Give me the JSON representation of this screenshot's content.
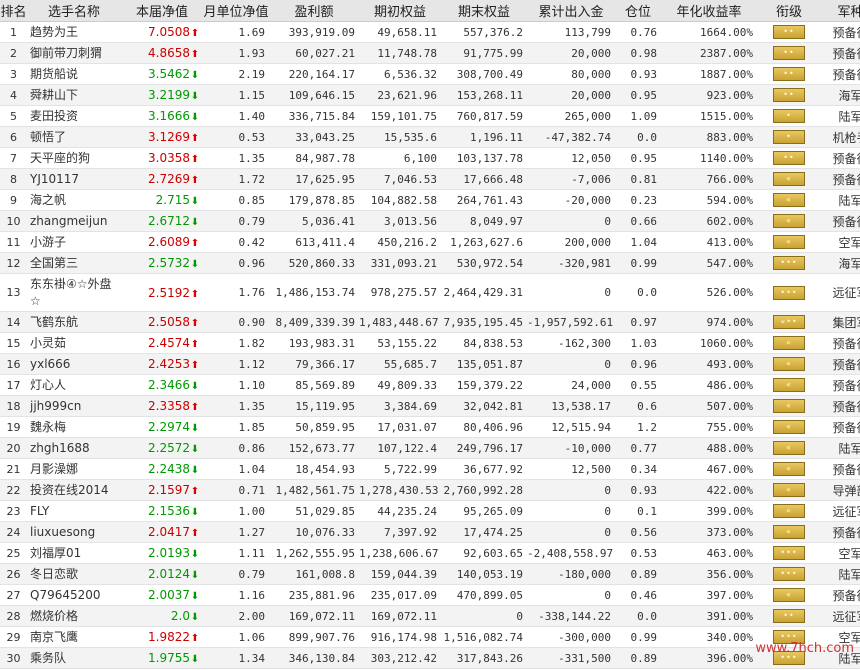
{
  "headers": [
    "排名",
    "选手名称",
    "本届净值",
    "月单位净值",
    "盈利额",
    "期初权益",
    "期末权益",
    "累计出入金",
    "仓位",
    "年化收益率",
    "衔级",
    "军种"
  ],
  "rows": [
    {
      "rank": "1",
      "name": "趋势为王",
      "nav": "7.0508",
      "dir": "up",
      "unit": "1.69",
      "profit": "393,919.09",
      "start": "49,658.11",
      "end": "557,376.2",
      "flow": "113,799",
      "pos": "0.76",
      "annual": "1664.00%",
      "badge": "••",
      "army": "预备役"
    },
    {
      "rank": "2",
      "name": "御前带刀刺猬",
      "nav": "4.8658",
      "dir": "up",
      "unit": "1.93",
      "profit": "60,027.21",
      "start": "11,748.78",
      "end": "91,775.99",
      "flow": "20,000",
      "pos": "0.98",
      "annual": "2387.00%",
      "badge": "••",
      "army": "预备役"
    },
    {
      "rank": "3",
      "name": "期货船说",
      "nav": "3.5462",
      "dir": "dn",
      "unit": "2.19",
      "profit": "220,164.17",
      "start": "6,536.32",
      "end": "308,700.49",
      "flow": "80,000",
      "pos": "0.93",
      "annual": "1887.00%",
      "badge": "••",
      "army": "预备役"
    },
    {
      "rank": "4",
      "name": "舜耕山下",
      "nav": "3.2199",
      "dir": "dn",
      "unit": "1.15",
      "profit": "109,646.15",
      "start": "23,621.96",
      "end": "153,268.11",
      "flow": "20,000",
      "pos": "0.95",
      "annual": "923.00%",
      "badge": "••",
      "army": "海军"
    },
    {
      "rank": "5",
      "name": "麦田投资",
      "nav": "3.1666",
      "dir": "dn",
      "unit": "1.40",
      "profit": "336,715.84",
      "start": "159,101.75",
      "end": "760,817.59",
      "flow": "265,000",
      "pos": "1.09",
      "annual": "1515.00%",
      "badge": "•",
      "army": "陆军"
    },
    {
      "rank": "6",
      "name": "顿悟了",
      "nav": "3.1269",
      "dir": "up",
      "unit": "0.53",
      "profit": "33,043.25",
      "start": "15,535.6",
      "end": "1,196.11",
      "flow": "-47,382.74",
      "pos": "0.0",
      "annual": "883.00%",
      "badge": "•",
      "army": "机枪手"
    },
    {
      "rank": "7",
      "name": "天平座的狗",
      "nav": "3.0358",
      "dir": "up",
      "unit": "1.35",
      "profit": "84,987.78",
      "start": "6,100",
      "end": "103,137.78",
      "flow": "12,050",
      "pos": "0.95",
      "annual": "1140.00%",
      "badge": "••",
      "army": "预备役"
    },
    {
      "rank": "8",
      "name": "YJ10117",
      "nav": "2.7269",
      "dir": "up",
      "unit": "1.72",
      "profit": "17,625.95",
      "start": "7,046.53",
      "end": "17,666.48",
      "flow": "-7,006",
      "pos": "0.81",
      "annual": "766.00%",
      "badge": "«",
      "army": "预备役"
    },
    {
      "rank": "9",
      "name": "海之帆",
      "nav": "2.715",
      "dir": "dn",
      "unit": "0.85",
      "profit": "179,878.85",
      "start": "104,882.58",
      "end": "264,761.43",
      "flow": "-20,000",
      "pos": "0.23",
      "annual": "594.00%",
      "badge": "«",
      "army": "陆军"
    },
    {
      "rank": "10",
      "name": "zhangmeijun",
      "nav": "2.6712",
      "dir": "dn",
      "unit": "0.79",
      "profit": "5,036.41",
      "start": "3,013.56",
      "end": "8,049.97",
      "flow": "0",
      "pos": "0.66",
      "annual": "602.00%",
      "badge": "«",
      "army": "预备役"
    },
    {
      "rank": "11",
      "name": "小游子",
      "nav": "2.6089",
      "dir": "up",
      "unit": "0.42",
      "profit": "613,411.4",
      "start": "450,216.2",
      "end": "1,263,627.6",
      "flow": "200,000",
      "pos": "1.04",
      "annual": "413.00%",
      "badge": "«",
      "army": "空军"
    },
    {
      "rank": "12",
      "name": "全国第三",
      "nav": "2.5732",
      "dir": "dn",
      "unit": "0.96",
      "profit": "520,860.33",
      "start": "331,093.21",
      "end": "530,972.54",
      "flow": "-320,981",
      "pos": "0.99",
      "annual": "547.00%",
      "badge": "•••",
      "army": "海军"
    },
    {
      "rank": "13",
      "name": "东东褂④☆外盘☆",
      "nav": "2.5192",
      "dir": "up",
      "unit": "1.76",
      "profit": "1,486,153.74",
      "start": "978,275.57",
      "end": "2,464,429.31",
      "flow": "0",
      "pos": "0.0",
      "annual": "526.00%",
      "badge": "•••",
      "army": "远征军"
    },
    {
      "rank": "14",
      "name": "飞鹤东航",
      "nav": "2.5058",
      "dir": "up",
      "unit": "0.90",
      "profit": "8,409,339.39",
      "start": "1,483,448.67",
      "end": "7,935,195.45",
      "flow": "-1,957,592.61",
      "pos": "0.97",
      "annual": "974.00%",
      "badge": "«••",
      "army": "集团军"
    },
    {
      "rank": "15",
      "name": "小灵茹",
      "nav": "2.4574",
      "dir": "up",
      "unit": "1.82",
      "profit": "193,983.31",
      "start": "53,155.22",
      "end": "84,838.53",
      "flow": "-162,300",
      "pos": "1.03",
      "annual": "1060.00%",
      "badge": "«",
      "army": "预备役"
    },
    {
      "rank": "16",
      "name": "yxl666",
      "nav": "2.4253",
      "dir": "up",
      "unit": "1.12",
      "profit": "79,366.17",
      "start": "55,685.7",
      "end": "135,051.87",
      "flow": "0",
      "pos": "0.96",
      "annual": "493.00%",
      "badge": "«",
      "army": "预备役"
    },
    {
      "rank": "17",
      "name": "灯心人",
      "nav": "2.3466",
      "dir": "dn",
      "unit": "1.10",
      "profit": "85,569.89",
      "start": "49,809.33",
      "end": "159,379.22",
      "flow": "24,000",
      "pos": "0.55",
      "annual": "486.00%",
      "badge": "«",
      "army": "预备役"
    },
    {
      "rank": "18",
      "name": "jjh999cn",
      "nav": "2.3358",
      "dir": "up",
      "unit": "1.35",
      "profit": "15,119.95",
      "start": "3,384.69",
      "end": "32,042.81",
      "flow": "13,538.17",
      "pos": "0.6",
      "annual": "507.00%",
      "badge": "«",
      "army": "预备役"
    },
    {
      "rank": "19",
      "name": "魏永梅",
      "nav": "2.2974",
      "dir": "dn",
      "unit": "1.85",
      "profit": "50,859.95",
      "start": "17,031.07",
      "end": "80,406.96",
      "flow": "12,515.94",
      "pos": "1.2",
      "annual": "755.00%",
      "badge": "«",
      "army": "预备役"
    },
    {
      "rank": "20",
      "name": "zhgh1688",
      "nav": "2.2572",
      "dir": "dn",
      "unit": "0.86",
      "profit": "152,673.77",
      "start": "107,122.4",
      "end": "249,796.17",
      "flow": "-10,000",
      "pos": "0.77",
      "annual": "488.00%",
      "badge": "«",
      "army": "陆军"
    },
    {
      "rank": "21",
      "name": "月影澡娜",
      "nav": "2.2438",
      "dir": "dn",
      "unit": "1.04",
      "profit": "18,454.93",
      "start": "5,722.99",
      "end": "36,677.92",
      "flow": "12,500",
      "pos": "0.34",
      "annual": "467.00%",
      "badge": "«",
      "army": "预备役"
    },
    {
      "rank": "22",
      "name": "投资在线2014",
      "nav": "2.1597",
      "dir": "up",
      "unit": "0.71",
      "profit": "1,482,561.75",
      "start": "1,278,430.53",
      "end": "2,760,992.28",
      "flow": "0",
      "pos": "0.93",
      "annual": "422.00%",
      "badge": "«",
      "army": "导弹部"
    },
    {
      "rank": "23",
      "name": "FLY",
      "nav": "2.1536",
      "dir": "dn",
      "unit": "1.00",
      "profit": "51,029.85",
      "start": "44,235.24",
      "end": "95,265.09",
      "flow": "0",
      "pos": "0.1",
      "annual": "399.00%",
      "badge": "«",
      "army": "远征军"
    },
    {
      "rank": "24",
      "name": "liuxuesong",
      "nav": "2.0417",
      "dir": "up",
      "unit": "1.27",
      "profit": "10,076.33",
      "start": "7,397.92",
      "end": "17,474.25",
      "flow": "0",
      "pos": "0.56",
      "annual": "373.00%",
      "badge": "«",
      "army": "预备役"
    },
    {
      "rank": "25",
      "name": "刘福厚01",
      "nav": "2.0193",
      "dir": "dn",
      "unit": "1.11",
      "profit": "1,262,555.95",
      "start": "1,238,606.67",
      "end": "92,603.65",
      "flow": "-2,408,558.97",
      "pos": "0.53",
      "annual": "463.00%",
      "badge": "•••",
      "army": "空军"
    },
    {
      "rank": "26",
      "name": "冬日恋歌",
      "nav": "2.0124",
      "dir": "dn",
      "unit": "0.79",
      "profit": "161,008.8",
      "start": "159,044.39",
      "end": "140,053.19",
      "flow": "-180,000",
      "pos": "0.89",
      "annual": "356.00%",
      "badge": "•••",
      "army": "陆军"
    },
    {
      "rank": "27",
      "name": "Q79645200",
      "nav": "2.0037",
      "dir": "dn",
      "unit": "1.16",
      "profit": "235,881.96",
      "start": "235,017.09",
      "end": "470,899.05",
      "flow": "0",
      "pos": "0.46",
      "annual": "397.00%",
      "badge": "«",
      "army": "预备役"
    },
    {
      "rank": "28",
      "name": "燃烧价格",
      "nav": "2.0",
      "dir": "dn",
      "unit": "2.00",
      "profit": "169,072.11",
      "start": "169,072.11",
      "end": "0",
      "flow": "-338,144.22",
      "pos": "0.0",
      "annual": "391.00%",
      "badge": "••",
      "army": "远征军"
    },
    {
      "rank": "29",
      "name": "南京飞鹰",
      "nav": "1.9822",
      "dir": "up",
      "unit": "1.06",
      "profit": "899,907.76",
      "start": "916,174.98",
      "end": "1,516,082.74",
      "flow": "-300,000",
      "pos": "0.99",
      "annual": "340.00%",
      "badge": "•••",
      "army": "空军"
    },
    {
      "rank": "30",
      "name": "乘务队",
      "nav": "1.9755",
      "dir": "dn",
      "unit": "1.34",
      "profit": "346,130.84",
      "start": "303,212.42",
      "end": "317,843.26",
      "flow": "-331,500",
      "pos": "0.89",
      "annual": "396.00%",
      "badge": "•••",
      "army": "陆军"
    }
  ],
  "watermark": "www.7hch.com"
}
